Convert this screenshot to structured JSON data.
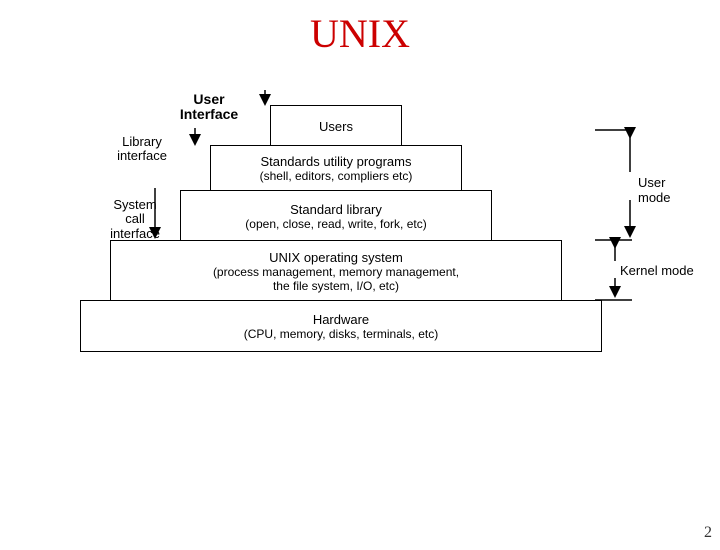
{
  "title": "UNIX",
  "ui_label_line1": "User",
  "ui_label_line2": "Interface",
  "interfaces": {
    "library": {
      "l1": "Library",
      "l2": "interface"
    },
    "syscall": {
      "l1": "System",
      "l2": "call",
      "l3": "interface"
    }
  },
  "layers": {
    "users": "Users",
    "utilities": {
      "main": "Standards utility programs",
      "sub": "(shell, editors, compliers etc)"
    },
    "stdlib": {
      "main": "Standard library",
      "sub": "(open, close, read, write, fork, etc)"
    },
    "os": {
      "main": "UNIX operating system",
      "sub1": "(process management, memory management,",
      "sub2": "the file system, I/O, etc)"
    },
    "hw": {
      "main": "Hardware",
      "sub": "(CPU, memory, disks, terminals, etc)"
    }
  },
  "modes": {
    "user": {
      "l1": "User",
      "l2": "mode"
    },
    "kernel": "Kernel mode"
  },
  "page_number": "2"
}
